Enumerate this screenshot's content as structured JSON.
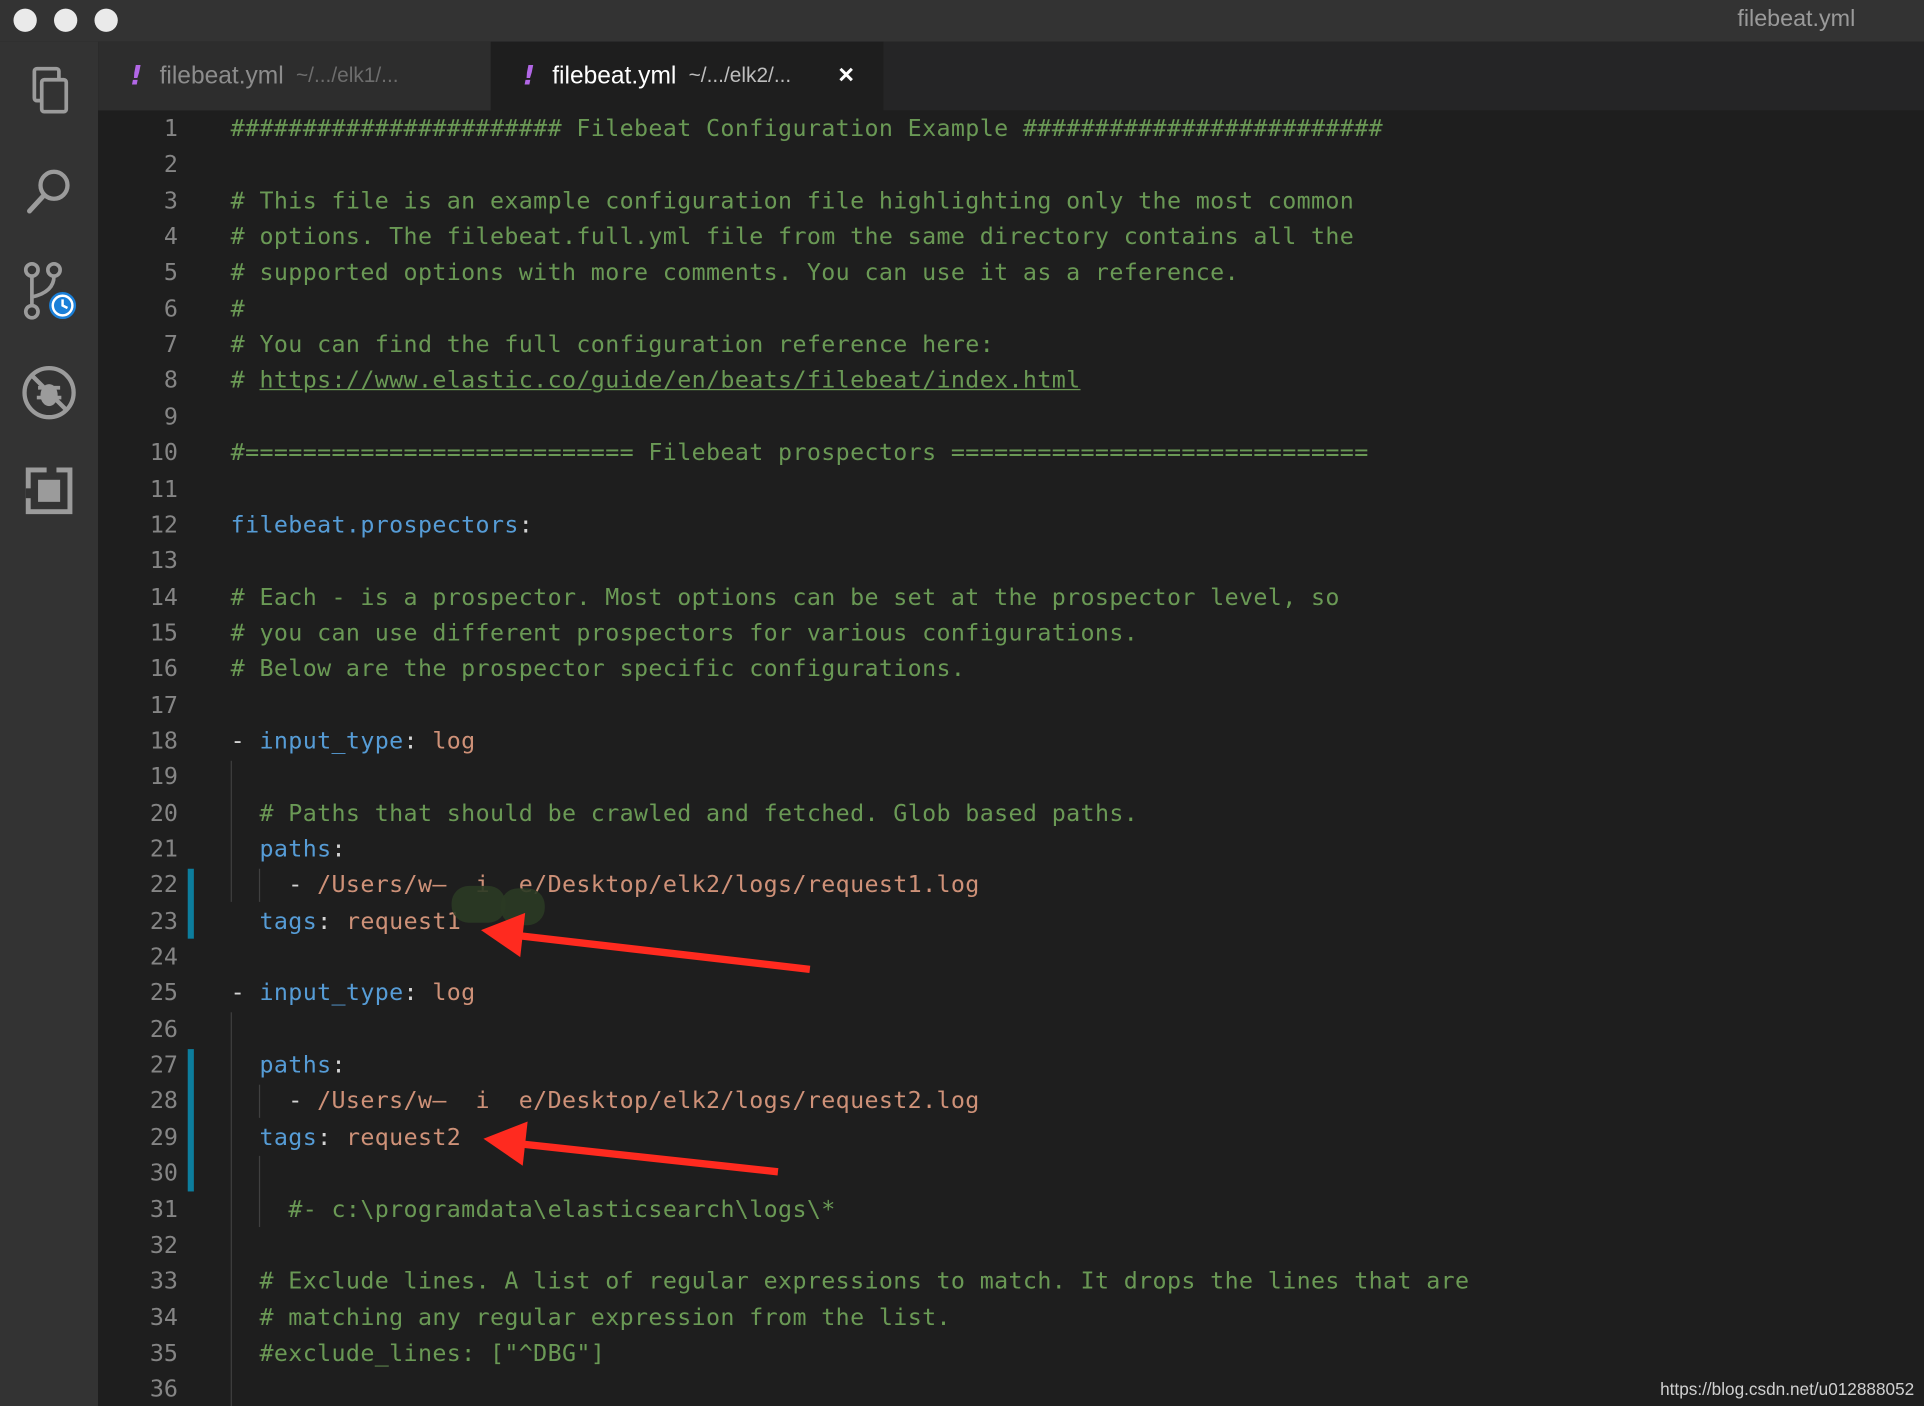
{
  "window": {
    "title": "filebeat.yml"
  },
  "activity_bar": {
    "items": [
      "explorer-icon",
      "search-icon",
      "source-control-icon",
      "debug-icon",
      "extensions-icon"
    ]
  },
  "tabs": [
    {
      "name": "filebeat.yml",
      "path": "~/.../elk1/...",
      "active": false
    },
    {
      "name": "filebeat.yml",
      "path": "~/.../elk2/...",
      "active": true,
      "close": "×"
    }
  ],
  "editor": {
    "lines": [
      {
        "n": "1",
        "segments": [
          [
            "comment",
            "####################### Filebeat Configuration Example #########################"
          ]
        ]
      },
      {
        "n": "2",
        "segments": []
      },
      {
        "n": "3",
        "segments": [
          [
            "comment",
            "# This file is an example configuration file highlighting only the most common"
          ]
        ]
      },
      {
        "n": "4",
        "segments": [
          [
            "comment",
            "# options. The filebeat.full.yml file from the same directory contains all the"
          ]
        ]
      },
      {
        "n": "5",
        "segments": [
          [
            "comment",
            "# supported options with more comments. You can use it as a reference."
          ]
        ]
      },
      {
        "n": "6",
        "segments": [
          [
            "comment",
            "#"
          ]
        ]
      },
      {
        "n": "7",
        "segments": [
          [
            "comment",
            "# You can find the full configuration reference here:"
          ]
        ]
      },
      {
        "n": "8",
        "segments": [
          [
            "comment",
            "# "
          ],
          [
            "link",
            "https://www.elastic.co/guide/en/beats/filebeat/index.html"
          ]
        ]
      },
      {
        "n": "9",
        "segments": []
      },
      {
        "n": "10",
        "segments": [
          [
            "comment",
            "#=========================== Filebeat prospectors ============================="
          ]
        ]
      },
      {
        "n": "11",
        "segments": []
      },
      {
        "n": "12",
        "segments": [
          [
            "key",
            "filebeat.prospectors"
          ],
          [
            "punc",
            ":"
          ]
        ]
      },
      {
        "n": "13",
        "segments": []
      },
      {
        "n": "14",
        "segments": [
          [
            "comment",
            "# Each - is a prospector. Most options can be set at the prospector level, so"
          ]
        ]
      },
      {
        "n": "15",
        "segments": [
          [
            "comment",
            "# you can use different prospectors for various configurations."
          ]
        ]
      },
      {
        "n": "16",
        "segments": [
          [
            "comment",
            "# Below are the prospector specific configurations."
          ]
        ]
      },
      {
        "n": "17",
        "segments": []
      },
      {
        "n": "18",
        "segments": [
          [
            "punc",
            "- "
          ],
          [
            "key",
            "input_type"
          ],
          [
            "punc",
            ": "
          ],
          [
            "val",
            "log"
          ]
        ]
      },
      {
        "n": "19",
        "segments": []
      },
      {
        "n": "20",
        "segments": [
          [
            "punc",
            "  "
          ],
          [
            "comment",
            "# Paths that should be crawled and fetched. Glob based paths."
          ]
        ]
      },
      {
        "n": "21",
        "segments": [
          [
            "punc",
            "  "
          ],
          [
            "key",
            "paths"
          ],
          [
            "punc",
            ":"
          ]
        ]
      },
      {
        "n": "22",
        "segments": [
          [
            "punc",
            "    - "
          ],
          [
            "val",
            "/Users/w—  i  e/Desktop/elk2/logs/request1.log"
          ]
        ]
      },
      {
        "n": "23",
        "segments": [
          [
            "punc",
            "  "
          ],
          [
            "key",
            "tags"
          ],
          [
            "punc",
            ": "
          ],
          [
            "val",
            "request1"
          ]
        ]
      },
      {
        "n": "24",
        "segments": []
      },
      {
        "n": "25",
        "segments": [
          [
            "punc",
            "- "
          ],
          [
            "key",
            "input_type"
          ],
          [
            "punc",
            ": "
          ],
          [
            "val",
            "log"
          ]
        ]
      },
      {
        "n": "26",
        "segments": []
      },
      {
        "n": "27",
        "segments": [
          [
            "punc",
            "  "
          ],
          [
            "key",
            "paths"
          ],
          [
            "punc",
            ":"
          ]
        ]
      },
      {
        "n": "28",
        "segments": [
          [
            "punc",
            "    - "
          ],
          [
            "val",
            "/Users/w—  i  e/Desktop/elk2/logs/request2.log"
          ]
        ]
      },
      {
        "n": "29",
        "segments": [
          [
            "punc",
            "  "
          ],
          [
            "key",
            "tags"
          ],
          [
            "punc",
            ": "
          ],
          [
            "val",
            "request2"
          ]
        ]
      },
      {
        "n": "30",
        "segments": []
      },
      {
        "n": "31",
        "segments": [
          [
            "punc",
            "    "
          ],
          [
            "comment",
            "#- c:\\programdata\\elasticsearch\\logs\\*"
          ]
        ]
      },
      {
        "n": "32",
        "segments": []
      },
      {
        "n": "33",
        "segments": [
          [
            "punc",
            "  "
          ],
          [
            "comment",
            "# Exclude lines. A list of regular expressions to match. It drops the lines that are"
          ]
        ]
      },
      {
        "n": "34",
        "segments": [
          [
            "punc",
            "  "
          ],
          [
            "comment",
            "# matching any regular expression from the list."
          ]
        ]
      },
      {
        "n": "35",
        "segments": [
          [
            "punc",
            "  "
          ],
          [
            "comment",
            "#exclude_lines: [\"^DBG\"]"
          ]
        ]
      },
      {
        "n": "36",
        "segments": []
      }
    ]
  },
  "watermark": "https://blog.csdn.net/u012888052",
  "colors": {
    "comment": "#6a9955",
    "key": "#569cd6",
    "value": "#ce9178",
    "annotation_arrow": "#ff2a1f",
    "gutter_change": "#0c7d9d"
  }
}
